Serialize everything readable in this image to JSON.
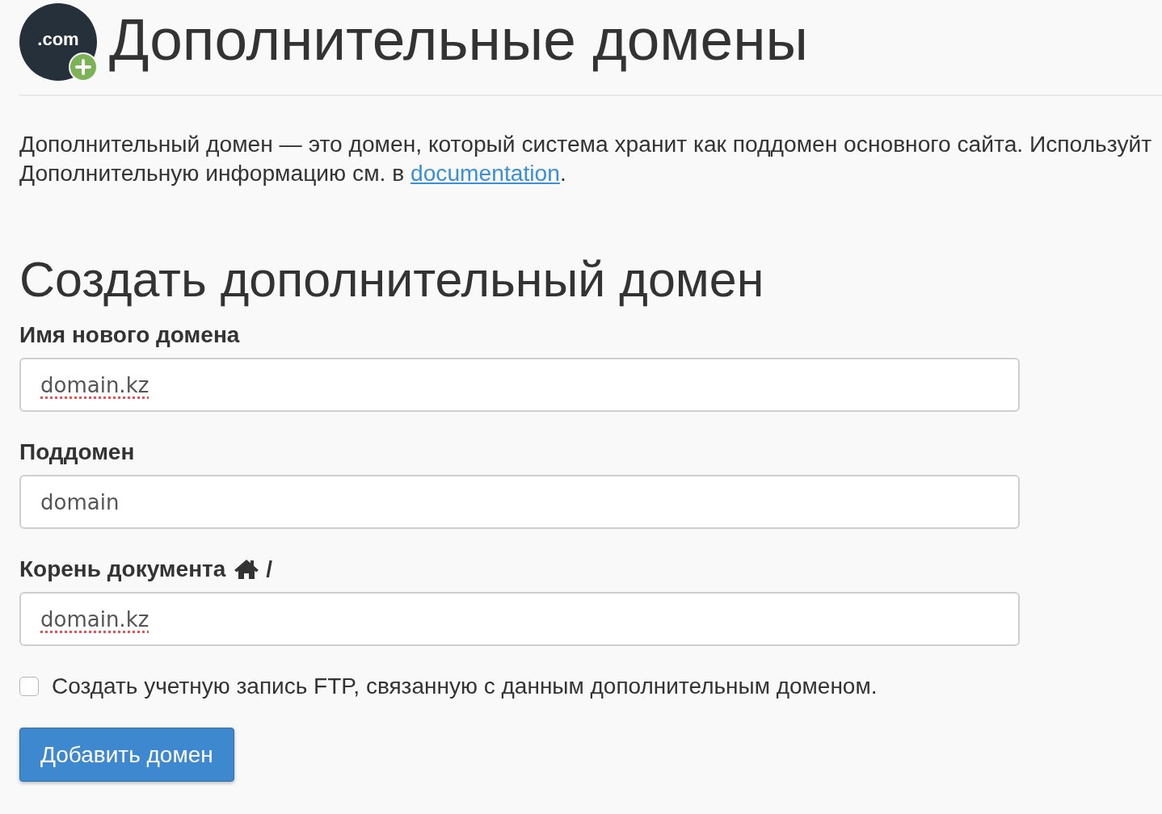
{
  "header": {
    "logo_text": ".com",
    "title": "Дополнительные домены"
  },
  "intro": {
    "line_1": "Дополнительный домен — это домен, который система хранит как поддомен основного сайта. Используйт",
    "line_2": "Дополнительную информацию см. в ",
    "link": "documentation",
    "line_2_end": "."
  },
  "form": {
    "title": "Создать дополнительный домен",
    "fields": [
      {
        "kind": "text",
        "label": "Имя нового домена",
        "value": "domain.kz",
        "spelling_error": true
      },
      {
        "kind": "text",
        "label": "Поддомен",
        "value": "domain",
        "spelling_error": false
      },
      {
        "kind": "path",
        "label": "Корень документа",
        "suffix": "/",
        "value": "domain.kz",
        "spelling_error": true
      }
    ],
    "ftp_option": {
      "label": "Создать учетную запись FTP, связанную с данным дополнительным доменом.",
      "checked": false
    },
    "submit": "Добавить домен"
  }
}
